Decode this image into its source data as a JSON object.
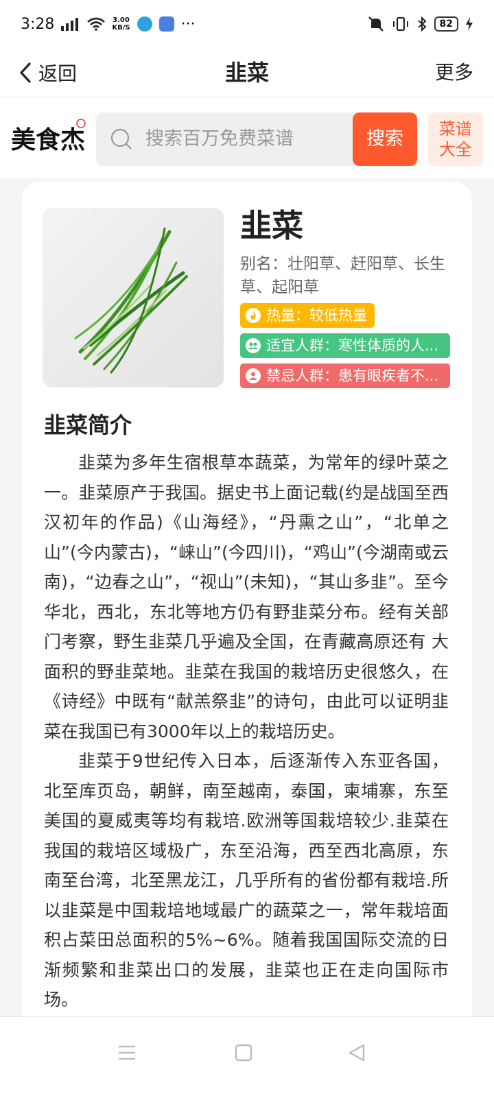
{
  "status_bar": {
    "time": "3:28",
    "speed_value": "3.00",
    "speed_unit": "KB/S",
    "battery": "82"
  },
  "header": {
    "back_label": "返回",
    "title": "韭菜",
    "more_label": "更多"
  },
  "search": {
    "logo_text": "美食杰",
    "placeholder": "搜索百万免费菜谱",
    "button_label": "搜索",
    "recipes_label_line1": "菜谱",
    "recipes_label_line2": "大全"
  },
  "food": {
    "name": "韭菜",
    "alias": "别名：壮阳草、赶阳草、长生草、起阳草",
    "calorie": "热量：较低热量",
    "suitable": "适宜人群：寒性体质的人...",
    "avoid": "禁忌人群：患有眼疾者不..."
  },
  "intro": {
    "title": "韭菜简介",
    "p1": "韭菜为多年生宿根草本蔬菜，为常年的绿叶菜之一。韭菜原产于我国。据史书上面记载(约是战国至西汉初年的作品)《山海经》，“丹熏之山”，“北单之山”(今内蒙古)，“崃山”(今四川)，“鸡山”(今湖南或云南)，“边春之山”，“视山”(未知)，“其山多韭”。至今华北，西北，东北等地方仍有野韭菜分布。经有关部门考察，野生韭菜几乎遍及全国，在青藏高原还有 大面积的野韭菜地。韭菜在我国的栽培历史很悠久，在《诗经》中既有“献羔祭韭”的诗句，由此可以证明韭菜在我国已有3000年以上的栽培历史。",
    "p2": "韭菜于9世纪传入日本，后逐渐传入东亚各国，北至库页岛，朝鲜，南至越南，泰国，柬埔寨，东至美国的夏威夷等均有栽培.欧洲等国栽培较少.韭菜在我国的栽培区域极广，东至沿海，西至西北高原，东南至台湾，北至黑龙江，几乎所有的省份都有栽培.所以韭菜是中国栽培地域最广的蔬菜之一，常年栽培面积占菜田总面积的5%~6%。随着我国国际交流的日渐频繁和韭菜出口的发展，韭菜也正在走向国际市场。"
  },
  "colors": {
    "accent": "#ff5a2e",
    "calorie_tag": "#ffb800",
    "suitable_tag": "#46c482",
    "avoid_tag": "#f06a6a"
  }
}
